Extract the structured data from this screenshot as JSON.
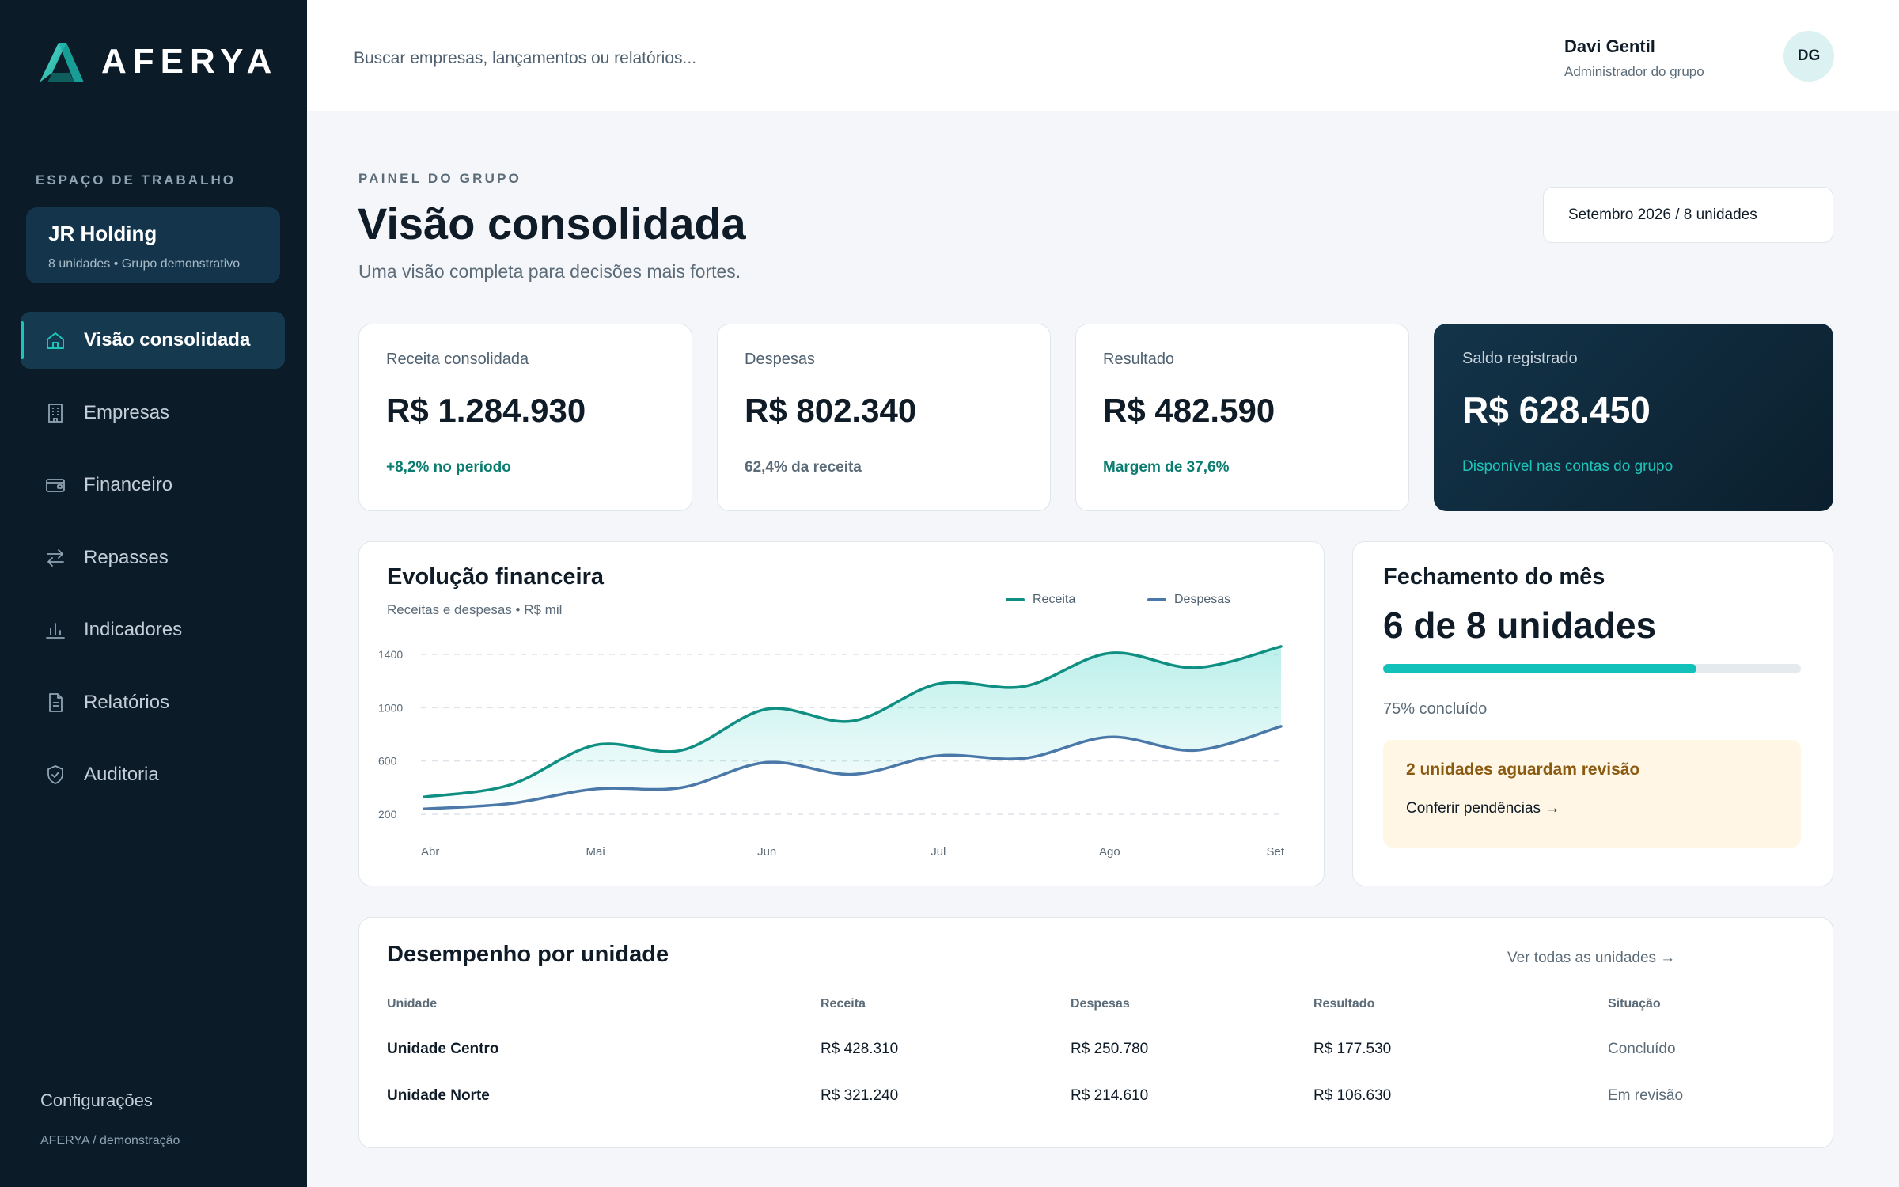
{
  "brand": {
    "name": "AFERYA",
    "accent": "#1fc4b8",
    "sidebar_bg": "#0b1b27"
  },
  "workspace": {
    "label": "ESPAÇO DE TRABALHO",
    "name": "JR Holding",
    "subtitle": "8 unidades • Grupo demonstrativo"
  },
  "sidebar": {
    "items": [
      {
        "label": "Visão consolidada",
        "icon": "home-icon",
        "active": true
      },
      {
        "label": "Empresas",
        "icon": "building-icon"
      },
      {
        "label": "Financeiro",
        "icon": "wallet-icon"
      },
      {
        "label": "Repasses",
        "icon": "transfer-icon"
      },
      {
        "label": "Indicadores",
        "icon": "bar-chart-icon"
      },
      {
        "label": "Relatórios",
        "icon": "document-icon"
      },
      {
        "label": "Auditoria",
        "icon": "shield-check-icon"
      }
    ],
    "settings": "Configurações",
    "footer": "AFERYA / demonstração"
  },
  "topbar": {
    "search_placeholder": "Buscar empresas, lançamentos ou relatórios...",
    "user_name": "Davi Gentil",
    "user_role": "Administrador do grupo",
    "avatar_initials": "DG"
  },
  "header": {
    "eyebrow": "PAINEL DO GRUPO",
    "title": "Visão consolidada",
    "subtitle": "Uma visão completa para decisões mais fortes.",
    "period": "Setembro 2026 / 8 unidades"
  },
  "kpis": [
    {
      "label": "Receita consolidada",
      "value": "R$ 1.284.930",
      "note": "+8,2% no período"
    },
    {
      "label": "Despesas",
      "value": "R$ 802.340",
      "note": "62,4% da receita"
    },
    {
      "label": "Resultado",
      "value": "R$ 482.590",
      "note": "Margem de 37,6%"
    },
    {
      "label": "Saldo registrado",
      "value": "R$ 628.450",
      "note": "Disponível nas contas do grupo"
    }
  ],
  "chart_card": {
    "title": "Evolução financeira",
    "subtitle": "Receitas e despesas • R$ mil"
  },
  "chart_data": {
    "type": "area",
    "title": "Evolução financeira",
    "subtitle": "Receitas e despesas • R$ mil",
    "x": [
      0,
      0.5,
      1,
      1.5,
      2,
      2.5,
      3,
      3.5,
      4,
      4.5,
      5
    ],
    "categories": [
      "Abr",
      "Mai",
      "Jun",
      "Jul",
      "Ago",
      "Set"
    ],
    "yticks": [
      1400,
      1000,
      600,
      200
    ],
    "ylim": [
      200,
      1400
    ],
    "grid": true,
    "legend": "top-right",
    "series": [
      {
        "name": "Receita",
        "color": "#0f8f82",
        "values": [
          330,
          420,
          720,
          680,
          990,
          900,
          1180,
          1160,
          1410,
          1300,
          1460
        ]
      },
      {
        "name": "Despesas",
        "color": "#4a78a8",
        "values": [
          240,
          280,
          390,
          400,
          590,
          500,
          640,
          620,
          780,
          680,
          860
        ]
      }
    ]
  },
  "closing": {
    "title": "Fechamento do mês",
    "headline": "6 de 8 unidades",
    "progress": 0.75,
    "progress_text": "75% concluído",
    "alert_title": "2 unidades aguardam revisão",
    "alert_link": "Conferir pendências →"
  },
  "table": {
    "title": "Desempenho por unidade",
    "view_all": "Ver todas as unidades →",
    "headers": [
      "Unidade",
      "Receita",
      "Despesas",
      "Resultado",
      "Situação"
    ],
    "rows": [
      [
        "Unidade Centro",
        "R$ 428.310",
        "R$ 250.780",
        "R$ 177.530",
        "Concluído"
      ],
      [
        "Unidade Norte",
        "R$ 321.240",
        "R$ 214.610",
        "R$ 106.630",
        "Em revisão"
      ]
    ]
  }
}
